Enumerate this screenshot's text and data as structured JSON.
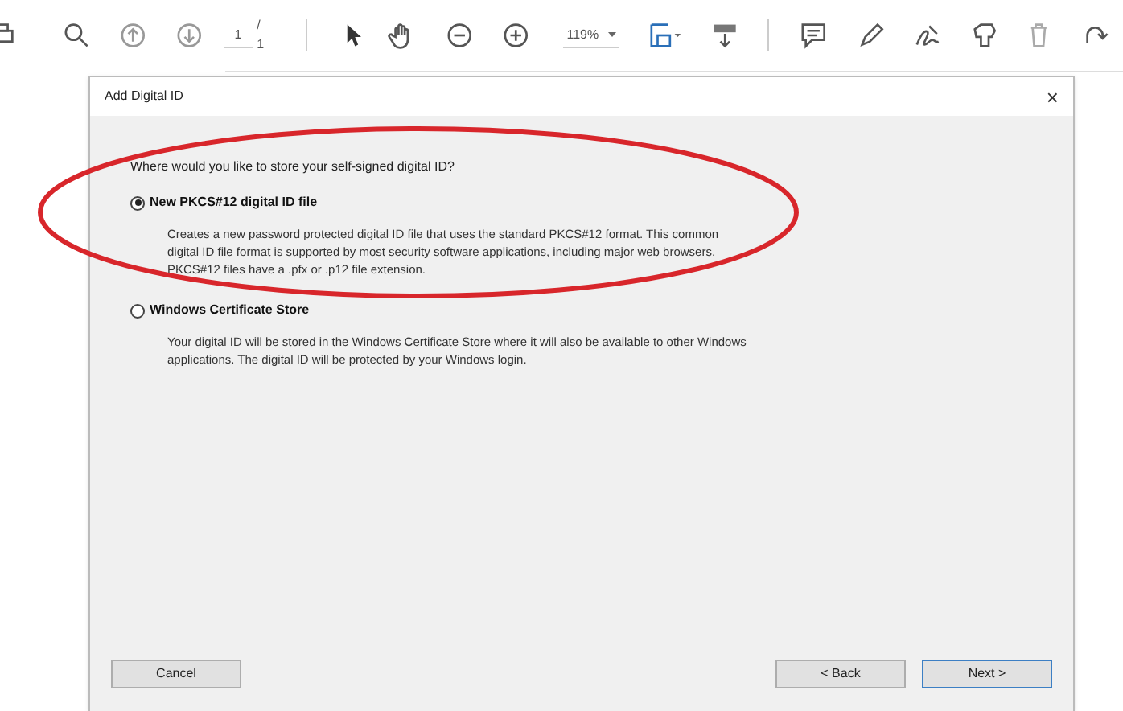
{
  "toolbar": {
    "page_field": {
      "value": "1"
    },
    "page_total": "/ 1",
    "zoom": {
      "value": "119%"
    }
  },
  "dialog": {
    "title": "Add Digital ID",
    "close": "×",
    "question": "Where would you like to store your self-signed digital ID?",
    "options": [
      {
        "label": "New PKCS#12 digital ID file",
        "selected": true,
        "description": "Creates a new password protected digital ID file that uses the standard PKCS#12 format. This common digital ID file format is supported by most security software applications, including major web browsers. PKCS#12 files have a .pfx or .p12 file extension."
      },
      {
        "label": "Windows Certificate Store",
        "selected": false,
        "description": "Your digital ID will be stored in the Windows Certificate Store where it will also be available to other Windows applications. The digital ID will be protected by your Windows login."
      }
    ],
    "buttons": [
      {
        "label": "Cancel",
        "default": false
      },
      {
        "label": "< Back",
        "default": false
      },
      {
        "label": "Next >",
        "default": true
      }
    ]
  }
}
